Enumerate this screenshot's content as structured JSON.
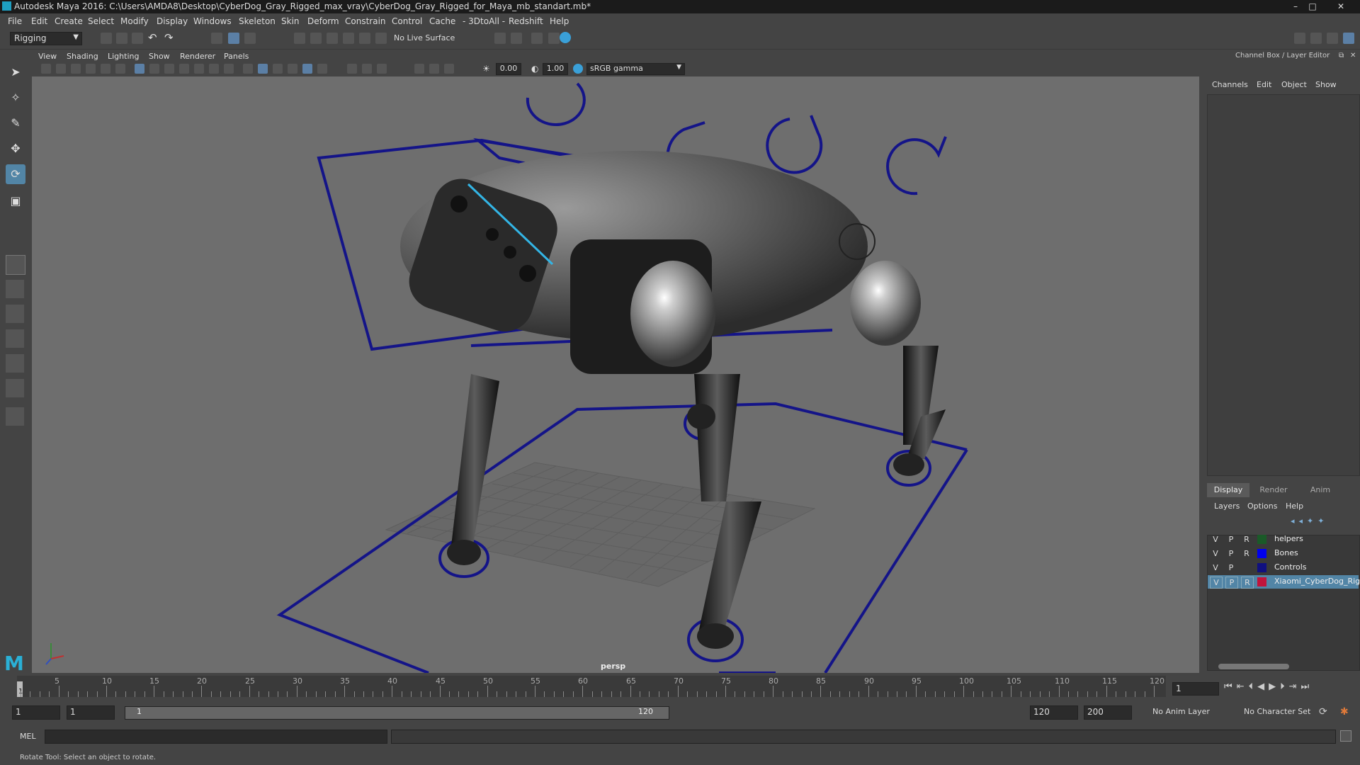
{
  "window": {
    "title": "Autodesk Maya 2016: C:\\Users\\AMDA8\\Desktop\\CyberDog_Gray_Rigged_max_vray\\CyberDog_Gray_Rigged_for_Maya_mb_standart.mb*",
    "min": "–",
    "max": "□",
    "close": "✕"
  },
  "menus": [
    "File",
    "Edit",
    "Create",
    "Select",
    "Modify",
    "Display",
    "Windows",
    "Skeleton",
    "Skin",
    "Deform",
    "Constrain",
    "Control",
    "Cache",
    "- 3DtoAll -",
    "Redshift",
    "Help"
  ],
  "shelf": {
    "mode": "Rigging",
    "live_surface": "No Live Surface"
  },
  "viewport": {
    "menus": [
      "View",
      "Shading",
      "Lighting",
      "Show",
      "Renderer",
      "Panels"
    ],
    "exposure": "0.00",
    "gamma": "1.00",
    "colorspace": "sRGB gamma",
    "camera": "persp"
  },
  "channel_box": {
    "header": "Channel Box / Layer Editor",
    "tabs": [
      "Channels",
      "Edit",
      "Object",
      "Show"
    ]
  },
  "layer_editor": {
    "tabs": [
      "Display",
      "Render",
      "Anim"
    ],
    "menus": [
      "Layers",
      "Options",
      "Help"
    ],
    "layers": [
      {
        "v": "V",
        "p": "P",
        "r": "R",
        "color": "#1a5a28",
        "name": "helpers",
        "selected": false
      },
      {
        "v": "V",
        "p": "P",
        "r": "R",
        "color": "#0000ee",
        "name": "Bones",
        "selected": false
      },
      {
        "v": "V",
        "p": "P",
        "r": "",
        "color": "#101080",
        "name": "Controls",
        "selected": false
      },
      {
        "v": "V",
        "p": "P",
        "r": "R",
        "color": "#c0143c",
        "name": "Xiaomi_CyberDog_Rigg",
        "selected": true
      }
    ]
  },
  "timeline": {
    "ticks": [
      "5",
      "10",
      "15",
      "20",
      "25",
      "30",
      "35",
      "40",
      "45",
      "50",
      "55",
      "60",
      "65",
      "70",
      "75",
      "80",
      "85",
      "90",
      "95",
      "100",
      "105",
      "110",
      "115",
      "120"
    ],
    "current_start": "1",
    "current_frame": "1"
  },
  "range": {
    "start": "1",
    "start2": "1",
    "slider_start": "1",
    "slider_end": "120",
    "end": "120",
    "end2": "200",
    "anim_layer": "No Anim Layer",
    "char_set": "No Character Set"
  },
  "cmd": {
    "label": "MEL"
  },
  "help_line": "Rotate Tool: Select an object to rotate."
}
